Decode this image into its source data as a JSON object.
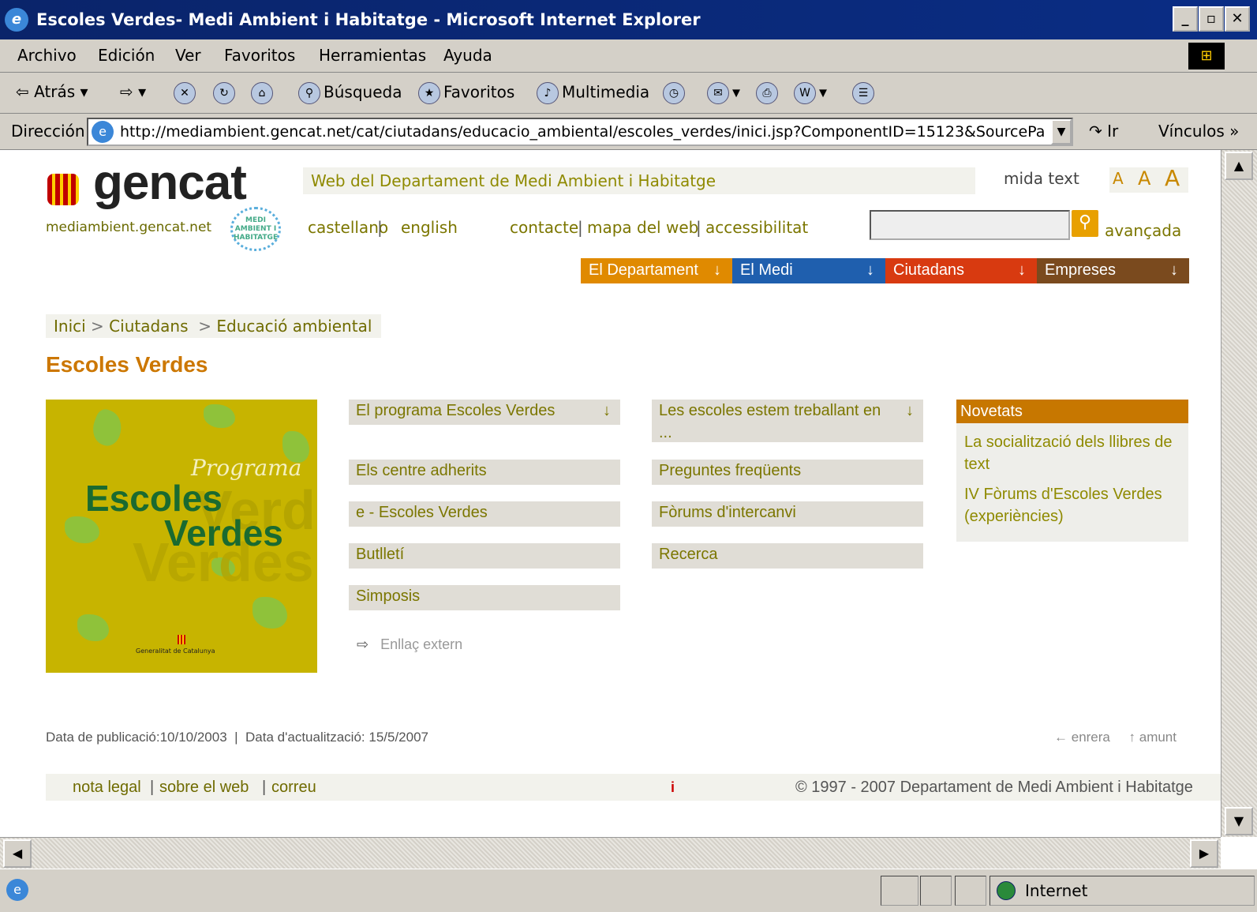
{
  "window": {
    "title": "Escoles Verdes- Medi Ambient i Habitatge - Microsoft Internet Explorer",
    "controls": [
      "_",
      "▫",
      "✕"
    ]
  },
  "menubar": {
    "items": [
      "Archivo",
      "Edición",
      "Ver",
      "Favoritos",
      "Herramientas",
      "Ayuda"
    ]
  },
  "toolbar": {
    "back_label": "Atrás",
    "search_label": "Búsqueda",
    "favorites_label": "Favoritos",
    "multimedia_label": "Multimedia"
  },
  "addressbar": {
    "label": "Dirección",
    "url": "http://mediambient.gencat.net/cat/ciutadans/educacio_ambiental/escoles_verdes/inici.jsp?ComponentID=15123&SourcePa",
    "go_label": "Ir",
    "links_label": "Vínculos"
  },
  "header": {
    "logo_text": "gencat",
    "domain": "mediambient.gencat.net",
    "badge_text": "MEDI AMBIENT I HABITATGE",
    "dept_web": "Web del Departament de Medi Ambient i Habitatge",
    "mida_text": "mida text",
    "sizes": [
      "A",
      "A",
      "A"
    ],
    "lang_castellano": "castellano",
    "lang_english": "english",
    "link_contacte": "contacte",
    "link_mapa": "mapa del web",
    "link_access": "accessibilitat",
    "search_advanced": "avançada"
  },
  "nav": {
    "tabs": [
      {
        "label": "El Departament",
        "color": "#e08a00"
      },
      {
        "label": "El Medi",
        "color": "#1f5fae"
      },
      {
        "label": "Ciutadans",
        "color": "#d83a10"
      },
      {
        "label": "Empreses",
        "color": "#7a4a1e"
      }
    ],
    "arrow": "↓"
  },
  "breadcrumb": {
    "items": [
      "Inici",
      "Ciutadans",
      "Educació ambiental"
    ],
    "separator": ">"
  },
  "page_title": "Escoles Verdes",
  "hero": {
    "script_text": "Programa",
    "word1": "Escoles",
    "word2": "Verdes",
    "ghost": "Verdes",
    "footer_text": "Generalitat de Catalunya"
  },
  "menu_col1": [
    {
      "label": "El programa Escoles Verdes",
      "arrow": "↓"
    },
    {
      "label": "Els centre adherits"
    },
    {
      "label": "e - Escoles Verdes"
    },
    {
      "label": "Butlletí"
    },
    {
      "label": "Simposis"
    }
  ],
  "menu_col2": [
    {
      "label": "Les escoles estem treballant en ...",
      "arrow": "↓"
    },
    {
      "label": "Preguntes freqüents"
    },
    {
      "label": "Fòrums d'intercanvi"
    },
    {
      "label": "Recerca"
    }
  ],
  "external_link": {
    "icon": "⇨",
    "label": "Enllaç extern"
  },
  "novetats": {
    "title": "Novetats",
    "items": [
      "La socialització dels llibres de text",
      "IV Fòrums d'Escoles Verdes (experiències)"
    ]
  },
  "dates": {
    "publication": "Data de publicació:10/10/2003",
    "update": "Data d'actualització: 15/5/2007"
  },
  "page_nav": {
    "back": "enrera",
    "up": "amunt"
  },
  "footer": {
    "nota_legal": "nota legal",
    "sobre": "sobre el web",
    "correu": "correu",
    "copyright": "© 1997 - 2007 Departament de Medi Ambient i Habitatge"
  },
  "statusbar": {
    "zone": "Internet"
  }
}
